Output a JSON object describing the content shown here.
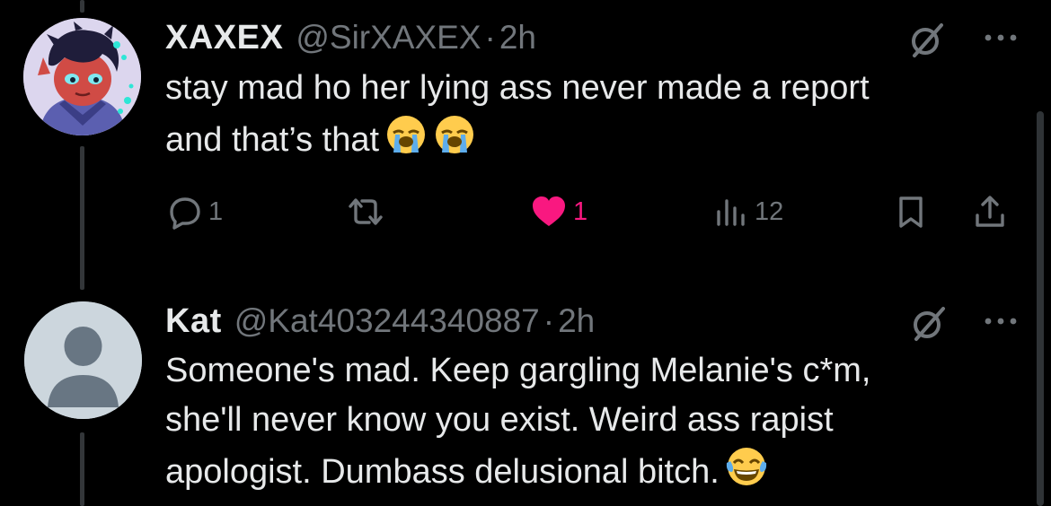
{
  "tweets": [
    {
      "name": "XAXEX",
      "handle": "@SirXAXEX",
      "separator": "·",
      "time": "2h",
      "lines": [
        "stay mad ho her lying ass never made a report",
        "and that’s that"
      ],
      "avatar_icon": "cartoon-avatar",
      "actions": {
        "reply_count": "1",
        "retweet_count": "",
        "like_count": "1",
        "views_count": "12"
      }
    },
    {
      "name": "Kat",
      "handle": "@Kat403244340887",
      "separator": "·",
      "time": "2h",
      "lines": [
        "Someone's mad. Keep gargling Melanie's c*m,",
        "she'll never know you exist. Weird ass rapist",
        "apologist. Dumbass delusional bitch."
      ],
      "avatar_icon": "default-avatar"
    }
  ],
  "colors": {
    "background": "#000000",
    "primary_text": "#e7e9ea",
    "secondary_text": "#71767b",
    "like_pink": "#f91880"
  }
}
